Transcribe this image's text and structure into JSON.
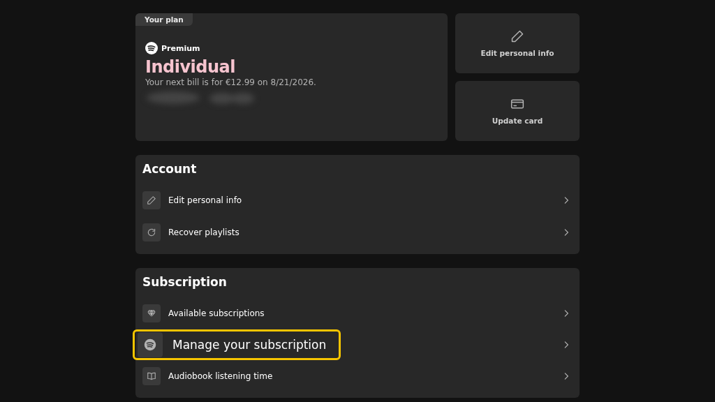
{
  "plan": {
    "tag": "Your plan",
    "brand": "Premium",
    "name": "Individual",
    "bill": "Your next bill is for €12.99 on 8/21/2026.",
    "redacted": true
  },
  "quick_actions": [
    {
      "kind": "pencil",
      "label": "Edit personal info"
    },
    {
      "kind": "card",
      "label": "Update card"
    }
  ],
  "sections": [
    {
      "title": "Account",
      "items": [
        {
          "kind": "pencil",
          "label": "Edit personal info",
          "highlighted": false
        },
        {
          "kind": "refresh",
          "label": "Recover playlists",
          "highlighted": false
        }
      ]
    },
    {
      "title": "Subscription",
      "items": [
        {
          "kind": "diamond",
          "label": "Available subscriptions",
          "highlighted": false
        },
        {
          "kind": "logo",
          "label": "Manage your subscription",
          "highlighted": true
        },
        {
          "kind": "book",
          "label": "Audiobook listening time",
          "highlighted": false
        }
      ]
    }
  ]
}
